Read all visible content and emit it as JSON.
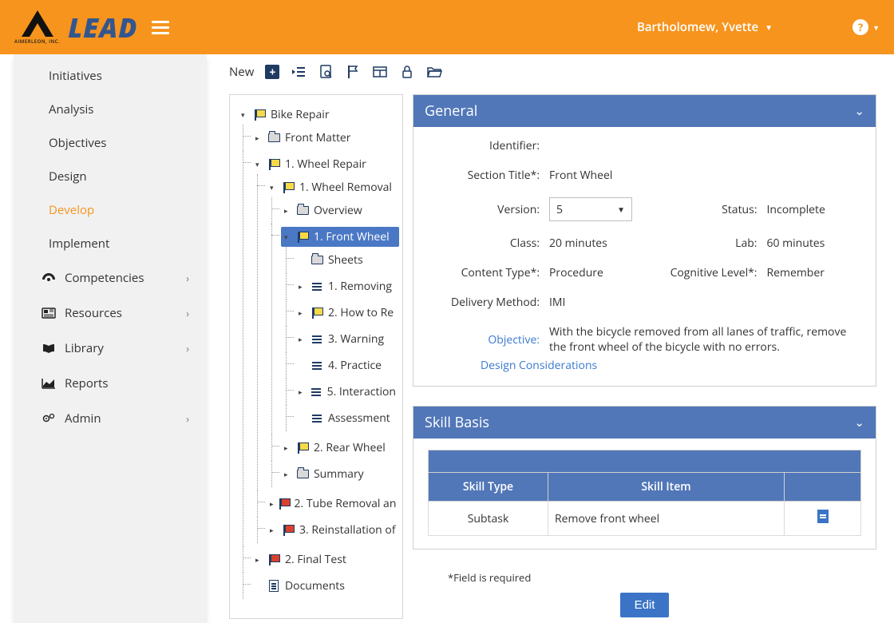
{
  "app": {
    "company_small": "AIMERLEON, INC.",
    "brand": "LEAD",
    "user_name": "Bartholomew, Yvette"
  },
  "sidebar": {
    "sub_items": [
      {
        "label": "Initiatives",
        "active": false
      },
      {
        "label": "Analysis",
        "active": false
      },
      {
        "label": "Objectives",
        "active": false
      },
      {
        "label": "Design",
        "active": false
      },
      {
        "label": "Develop",
        "active": true
      },
      {
        "label": "Implement",
        "active": false
      }
    ],
    "sections": [
      {
        "label": "Competencies"
      },
      {
        "label": "Resources"
      },
      {
        "label": "Library"
      },
      {
        "label": "Reports"
      },
      {
        "label": "Admin"
      }
    ]
  },
  "toolbar": {
    "new_label": "New"
  },
  "tree": {
    "root": "Bike Repair",
    "front_matter": "Front Matter",
    "wheel_repair": "1. Wheel Repair",
    "wheel_removal": "1. Wheel Removal",
    "overview": "Overview",
    "front_wheel": "1. Front Wheel",
    "sheets": "Sheets",
    "removing": "1. Removing",
    "howto": "2. How to Re",
    "warning": "3. Warning",
    "practice": "4. Practice",
    "interaction": "5. Interaction",
    "assessment": "Assessment",
    "rear_wheel": "2. Rear Wheel",
    "summary": "Summary",
    "tube_removal": "2. Tube Removal an",
    "reinstall": "3. Reinstallation of",
    "final_test": "2. Final Test",
    "documents": "Documents"
  },
  "general": {
    "title": "General",
    "labels": {
      "identifier": "Identifier:",
      "section_title": "Section Title*:",
      "version": "Version:",
      "status": "Status:",
      "class": "Class:",
      "lab": "Lab:",
      "content_type": "Content Type*:",
      "cognitive": "Cognitive Level*:",
      "delivery": "Delivery Method:",
      "objective": "Objective:"
    },
    "values": {
      "identifier": "",
      "section_title": "Front Wheel",
      "version": "5",
      "status": "Incomplete",
      "class": "20 minutes",
      "lab": "60 minutes",
      "content_type": "Procedure",
      "cognitive": "Remember",
      "delivery": "IMI",
      "objective": "With the bicycle removed from all lanes of traffic, remove the front wheel of the bicycle with no errors."
    },
    "design_link": "Design Considerations"
  },
  "skill": {
    "title": "Skill Basis",
    "headers": {
      "type": "Skill Type",
      "item": "Skill Item"
    },
    "rows": [
      {
        "type": "Subtask",
        "item": "Remove front wheel"
      }
    ],
    "required_note": "*Field is required",
    "edit_label": "Edit"
  }
}
